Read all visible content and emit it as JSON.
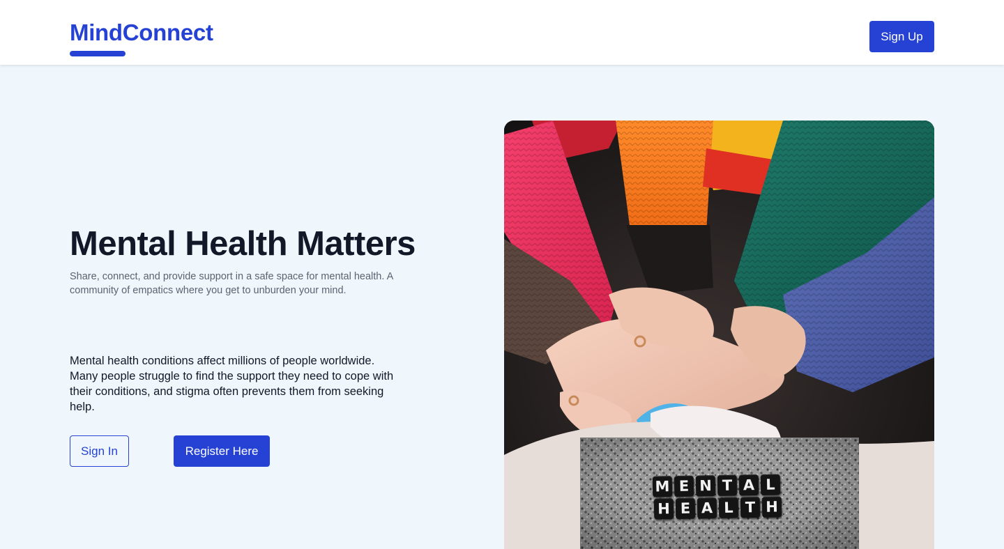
{
  "header": {
    "logo": "MindConnect",
    "signup_label": "Sign Up"
  },
  "hero": {
    "title": "Mental Health Matters",
    "subtitle": "Share, connect, and provide support in a safe space for mental health. A community of empatics where you get to unburden your mind.",
    "body": "Mental health conditions affect millions of people worldwide. Many people struggle to find the support they need to cope with their conditions, and stigma often prevents them from seeking help.",
    "signin_label": "Sign In",
    "register_label": "Register Here"
  },
  "inset": {
    "word1": [
      "M",
      "E",
      "N",
      "T",
      "A",
      "L"
    ],
    "word2": [
      "H",
      "E",
      "A",
      "L",
      "T",
      "H"
    ]
  },
  "colors": {
    "accent": "#2542d4",
    "page_background": "#eff7fd",
    "header_background": "#ffffff",
    "title_text": "#111827",
    "muted_text": "#5b6270"
  }
}
